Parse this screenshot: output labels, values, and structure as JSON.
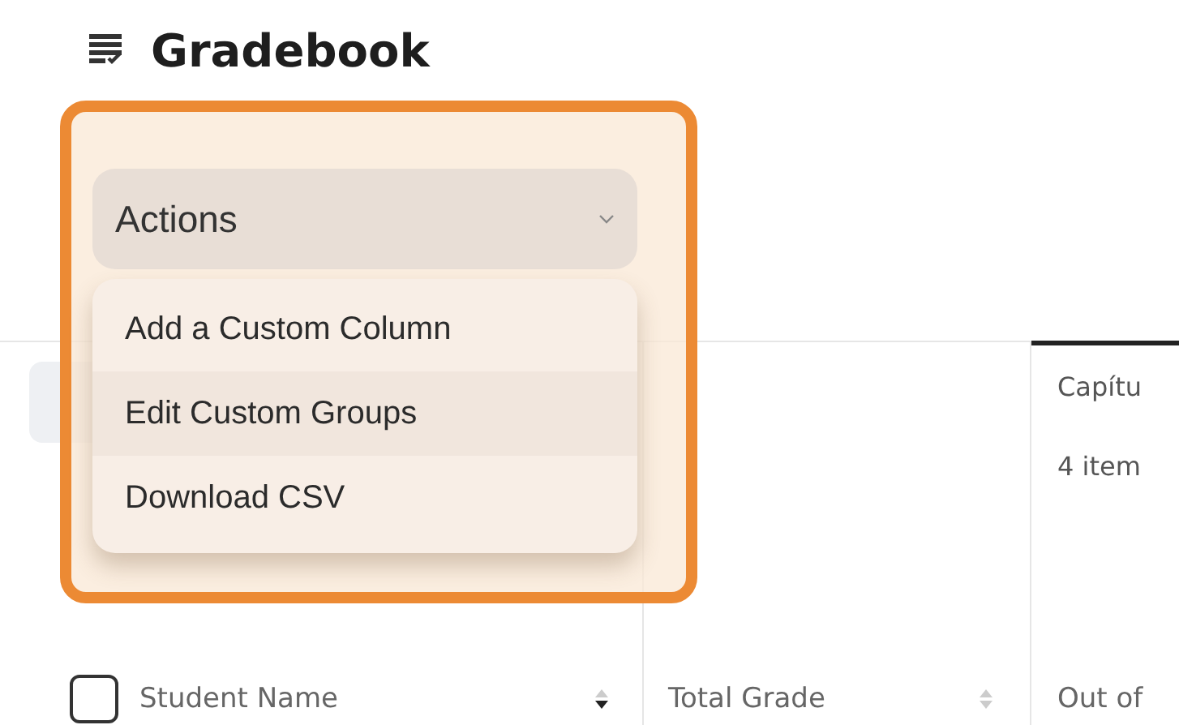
{
  "header": {
    "title": "Gradebook"
  },
  "actions": {
    "label": "Actions",
    "expanded": true,
    "menu": [
      {
        "label": "Add a Custom Column",
        "selected": false
      },
      {
        "label": "Edit Custom Groups",
        "selected": true
      },
      {
        "label": "Download CSV",
        "selected": false
      }
    ]
  },
  "chapter": {
    "title": "Capítu",
    "count": "4 item"
  },
  "table": {
    "columns": [
      {
        "label": "Student Name",
        "kind": "name",
        "checked": false
      },
      {
        "label": "Total Grade",
        "kind": "sortable"
      },
      {
        "label": "Out of",
        "kind": "plain"
      }
    ]
  }
}
